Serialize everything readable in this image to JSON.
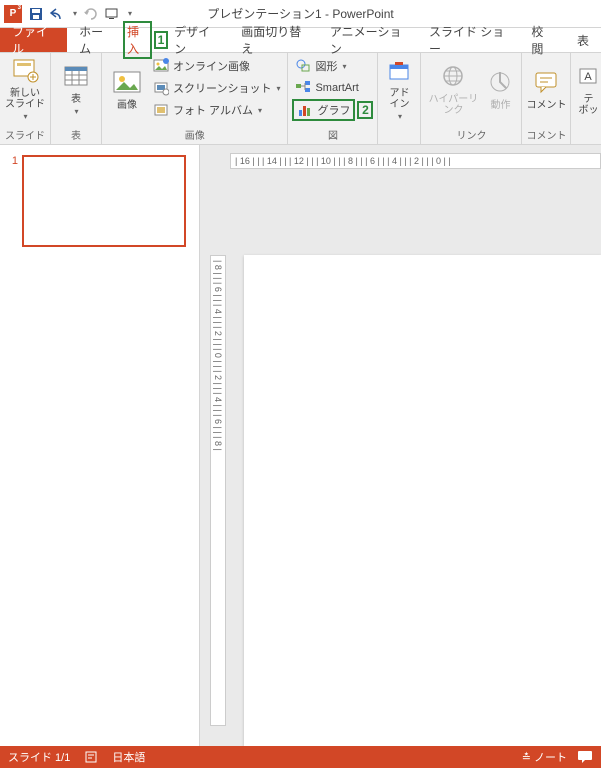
{
  "title": "プレゼンテーション1 - PowerPoint",
  "tabs": {
    "file": "ファイル",
    "home": "ホーム",
    "insert": "挿入",
    "design": "デザイン",
    "transitions": "画面切り替え",
    "animations": "アニメーション",
    "slideshow": "スライド ショー",
    "review": "校閲",
    "view": "表"
  },
  "callouts": {
    "one": "1",
    "two": "2"
  },
  "ribbon": {
    "new_slide": "新しい\nスライド",
    "table": "表",
    "picture": "画像",
    "online_image": "オンライン画像",
    "screenshot": "スクリーンショット",
    "photo_album": "フォト アルバム",
    "shapes": "図形",
    "smartart": "SmartArt",
    "chart": "グラフ",
    "addin": "アド\nイン",
    "hyperlink": "ハイパーリンク",
    "action": "動作",
    "comment": "コメント",
    "textbox": "テ\nボッ"
  },
  "groups": {
    "slides": "スライド",
    "tables": "表",
    "images": "画像",
    "illustrations": "図",
    "links": "リンク",
    "comments": "コメント"
  },
  "ruler_h": "| 16 | | | 14 | | | 12 | | | 10 | | | 8 | | | 6 | | | 4 | | | 2 | | | 0 | |",
  "ruler_v": "| 8 | | | 6 | | | 4 | | | 2 | | | 0 | | | 2 | | | 4 | | | 6 | | | 8 |",
  "thumb": {
    "num": "1"
  },
  "status": {
    "slide": "スライド 1/1",
    "lang": "日本語",
    "notes": "ノート"
  }
}
